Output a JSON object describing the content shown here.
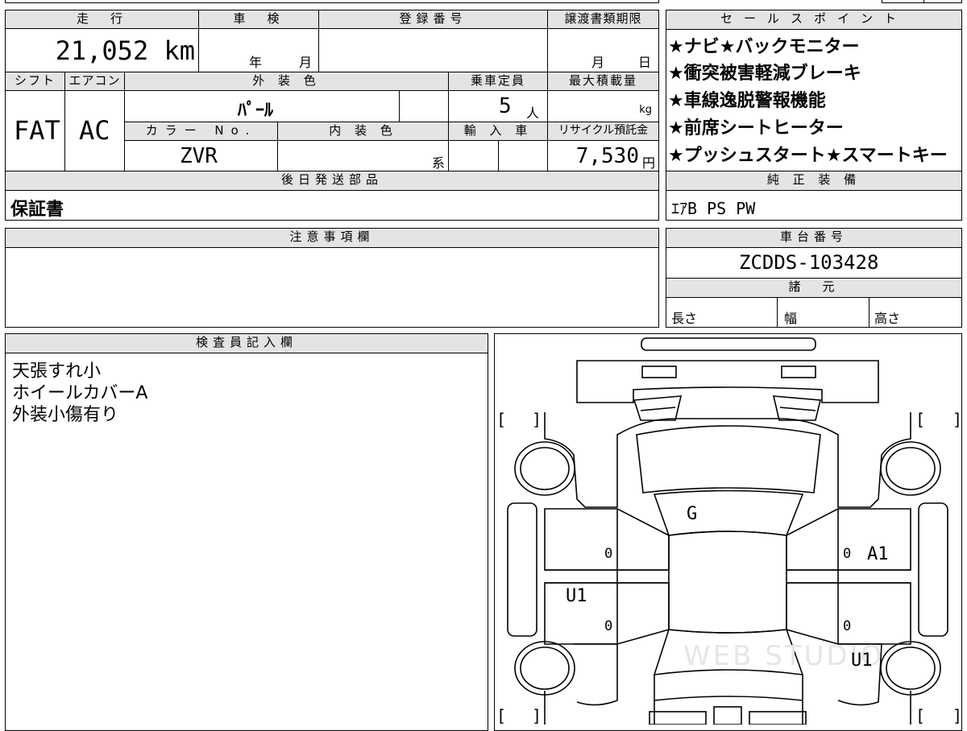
{
  "top_table": {
    "mileage_header": "走　行",
    "mileage_value": "21,052 km",
    "inspection_header": "車　検",
    "inspection_year": "年",
    "inspection_month": "月",
    "registration_header": "登録番号",
    "registration_value": "",
    "transfer_header": "譲渡書類期限",
    "transfer_month": "月",
    "transfer_day": "日",
    "shift_header": "シフト",
    "aircon_header": "エアコン",
    "exterior_header": "外 装 色",
    "capacity_header": "乗車定員",
    "maxload_header": "最大積載量",
    "shift_value": "FAT",
    "aircon_value": "AC",
    "exterior_value": "ﾊﾟｰﾙ",
    "capacity_value": "5",
    "capacity_unit": "人",
    "maxload_unit": "kg",
    "color_no_header": "カラー No.",
    "interior_header": "内 装 色",
    "import_header": "輸 入 車",
    "recycle_header": "リサイクル預託金",
    "color_no_value": "ZVR",
    "interior_suffix": "系",
    "recycle_value": "7,530",
    "recycle_unit": "円",
    "later_parts_header": "後日発送部品",
    "later_parts_value": "保証書"
  },
  "sales_points": {
    "header": "セールスポイント",
    "lines": [
      "★ナビ★バックモニター",
      "★衝突被害軽減ブレーキ",
      "★車線逸脱警報機能",
      "★前席シートヒーター",
      "★プッシュスタート★スマートキー"
    ]
  },
  "genuine_equipment": {
    "header": "純 正 装 備",
    "value": "ｴｱB PS PW"
  },
  "notes": {
    "header": "注意事項欄",
    "value": ""
  },
  "chassis": {
    "header": "車台番号",
    "value": "ZCDDS-103428"
  },
  "specs": {
    "header": "諸　元",
    "length": "長さ",
    "width": "幅",
    "height": "高さ"
  },
  "inspector": {
    "header": "検査員記入欄",
    "lines": [
      "天張すれ小",
      "ホイールカバーA",
      "外装小傷有り"
    ]
  },
  "diagram": {
    "marks": {
      "hood": "G",
      "front_right_fender": "A1",
      "left_rear_door": "U1",
      "right_rear": "U1",
      "zero_lf": "0",
      "zero_rf": "0",
      "zero_lr": "0",
      "zero_rr": "0"
    },
    "brackets": "[　　]"
  }
}
